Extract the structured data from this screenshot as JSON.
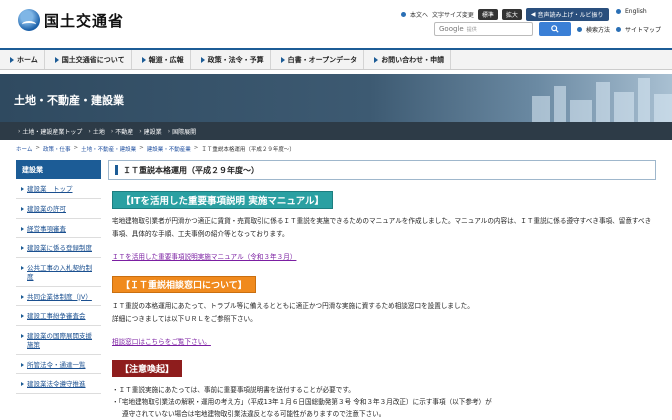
{
  "header": {
    "site_name": "国土交通省",
    "util": {
      "main_text": "本文へ",
      "font_size_label": "文字サイズ変更",
      "size_standard": "標準",
      "size_large": "拡大",
      "audio": "音声読み上げ・ルビ振り",
      "english": "English"
    },
    "search": {
      "google_label": "Google",
      "placeholder": "提供",
      "method": "検索方法",
      "sitemap": "サイトマップ"
    }
  },
  "global_nav": [
    "ホーム",
    "国土交通省について",
    "報道・広報",
    "政策・法令・予算",
    "白書・オープンデータ",
    "お問い合わせ・申請"
  ],
  "banner": {
    "title": "土地・不動産・建設業"
  },
  "sub_nav": [
    "土地・建設産業トップ",
    "土地",
    "不動産",
    "建設業",
    "国際展開"
  ],
  "breadcrumb": [
    "ホーム",
    "政策・仕事",
    "土地・不動産・建設業",
    "建設業・不動産業",
    "ＩＴ重説本格運用（平成２９年度〜）"
  ],
  "sidebar": {
    "heading": "建設業",
    "items": [
      "建設業　トップ",
      "建設業の許可",
      "経営事項審査",
      "建設業に係る登録制度",
      "公共工事の入札契約制度",
      "共同企業体制度（JV）",
      "建設工事紛争審査会",
      "建設業の国際展開支援施策",
      "所管法令・通達一覧",
      "建設業法令遵守推進"
    ]
  },
  "main": {
    "page_title": "ＩＴ重説本格運用（平成２９年度〜）",
    "section1_heading": "【ITを活用した重要事項説明 実施マニュアル】",
    "section1_text": "宅地建物取引業者が円滑かつ適正に賃貸・売買取引に係るＩＴ重説を実施できるためのマニュアルを作成しました。マニュアルの内容は、ＩＴ重説に係る遵守すべき事項、留意すべき事項、具体的な手順、工夫事例の紹介等となっております。",
    "section1_link": "ＩＴを活用した重要事項説明実施マニュアル（令和３年３月）",
    "section2_heading": "【ＩＴ重説相談窓口について】",
    "section2_text_1": "ＩＴ重説の本格運用にあたって、トラブル等に備えるとともに適正かつ円滑な実施に資するため相談窓口を設置しました。",
    "section2_text_2": "詳細につきましては以下ＵＲＬをご参照下さい。",
    "section2_link": "相談窓口はこちらをご覧下さい。",
    "section3_heading": "【注意喚起】",
    "bullet1": "・ＩＴ重説実施にあたっては、事前に重要事項説明書を送付することが必要です。",
    "bullet2": "・「宅地建物取引業法の解釈・運用の考え方」（平成13年１月６日国総動発第３号 令和３年３月改正）に示す事項（以下参考）が",
    "bullet2_cont": "遵守されていない場合は宅地建物取引業法違反となる可能性がありますので注意下さい。"
  },
  "colors": {
    "brand_blue": "#1c5c96",
    "teal": "#2aa0a2",
    "orange": "#f08a1d",
    "red": "#8e1d1d"
  }
}
